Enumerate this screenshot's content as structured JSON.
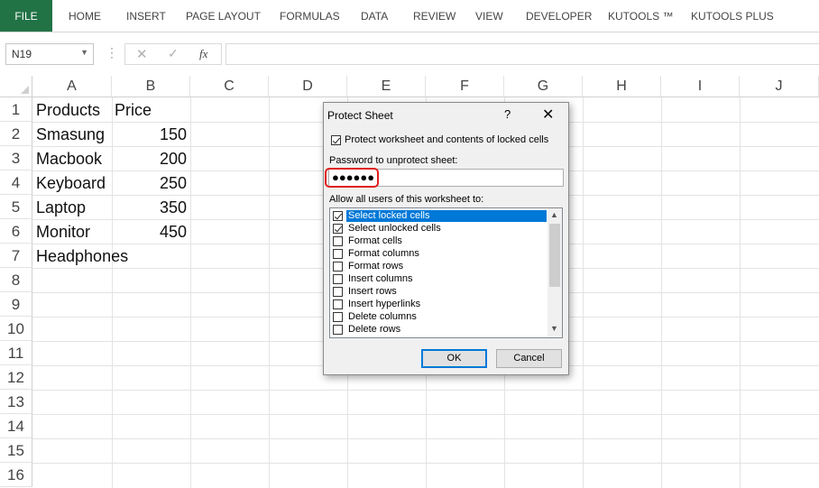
{
  "ribbon": {
    "tabs": [
      "FILE",
      "HOME",
      "INSERT",
      "PAGE LAYOUT",
      "FORMULAS",
      "DATA",
      "REVIEW",
      "VIEW",
      "DEVELOPER",
      "KUTOOLS ™",
      "KUTOOLS PLUS"
    ]
  },
  "formula_bar": {
    "name_box": "N19",
    "cancel_symbol": "✕",
    "enter_symbol": "✓",
    "fx_label": "fx",
    "content": ""
  },
  "sheet": {
    "columns": [
      "A",
      "B",
      "C",
      "D",
      "E",
      "F",
      "G",
      "H",
      "I",
      "J"
    ],
    "rows": [
      "1",
      "2",
      "3",
      "4",
      "5",
      "6",
      "7",
      "8",
      "9",
      "10",
      "11",
      "12",
      "13",
      "14",
      "15",
      "16"
    ],
    "cells": {
      "A1": "Products",
      "B1": "Price",
      "A2": "Smasung",
      "B2": "150",
      "A3": "Macbook",
      "B3": "200",
      "A4": "Keyboard",
      "B4": "250",
      "A5": "Laptop",
      "B5": "350",
      "A6": "Monitor",
      "B6": "450",
      "A7": "Headphones"
    }
  },
  "dialog": {
    "title": "Protect Sheet",
    "help": "?",
    "close": "✕",
    "protect_checkbox_label": "Protect worksheet and contents of locked cells",
    "protect_checked": true,
    "password_label": "Password to unprotect sheet:",
    "password_value": "●●●●●●",
    "allow_label": "Allow all users of this worksheet to:",
    "permissions": [
      {
        "label": "Select locked cells",
        "checked": true,
        "selected": true
      },
      {
        "label": "Select unlocked cells",
        "checked": true,
        "selected": false
      },
      {
        "label": "Format cells",
        "checked": false,
        "selected": false
      },
      {
        "label": "Format columns",
        "checked": false,
        "selected": false
      },
      {
        "label": "Format rows",
        "checked": false,
        "selected": false
      },
      {
        "label": "Insert columns",
        "checked": false,
        "selected": false
      },
      {
        "label": "Insert rows",
        "checked": false,
        "selected": false
      },
      {
        "label": "Insert hyperlinks",
        "checked": false,
        "selected": false
      },
      {
        "label": "Delete columns",
        "checked": false,
        "selected": false
      },
      {
        "label": "Delete rows",
        "checked": false,
        "selected": false
      }
    ],
    "ok_label": "OK",
    "cancel_label": "Cancel"
  },
  "colors": {
    "file_tab": "#217346",
    "selection": "#0078d7",
    "highlight": "#e0201d"
  }
}
